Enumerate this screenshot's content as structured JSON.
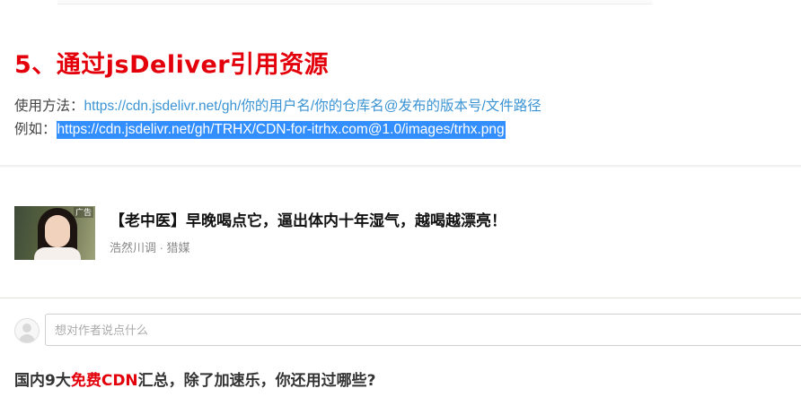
{
  "section": {
    "heading": "5、通过jsDeliver引用资源",
    "usage_label": "使用方法：",
    "usage_link": "https://cdn.jsdelivr.net/gh/你的用户名/你的仓库名@发布的版本号/文件路径",
    "example_label": "例如：",
    "example_link": "https://cdn.jsdelivr.net/gh/TRHX/CDN-for-itrhx.com@1.0/images/trhx.png"
  },
  "ad": {
    "badge": "广告",
    "title": "【老中医】早晚喝点它，逼出体内十年湿气，越喝越漂亮！",
    "source": "浩然川调 · 猎媒"
  },
  "comment": {
    "placeholder": "想对作者说点什么"
  },
  "related": {
    "prefix": "国内9大",
    "highlight": "免费CDN",
    "suffix": "汇总，除了加速乐，你还用过哪些?"
  },
  "colors": {
    "heading": "#e3000b",
    "link": "#3a93d3",
    "selection": "#338fff"
  },
  "icons": {
    "avatar": "user-avatar-icon"
  }
}
